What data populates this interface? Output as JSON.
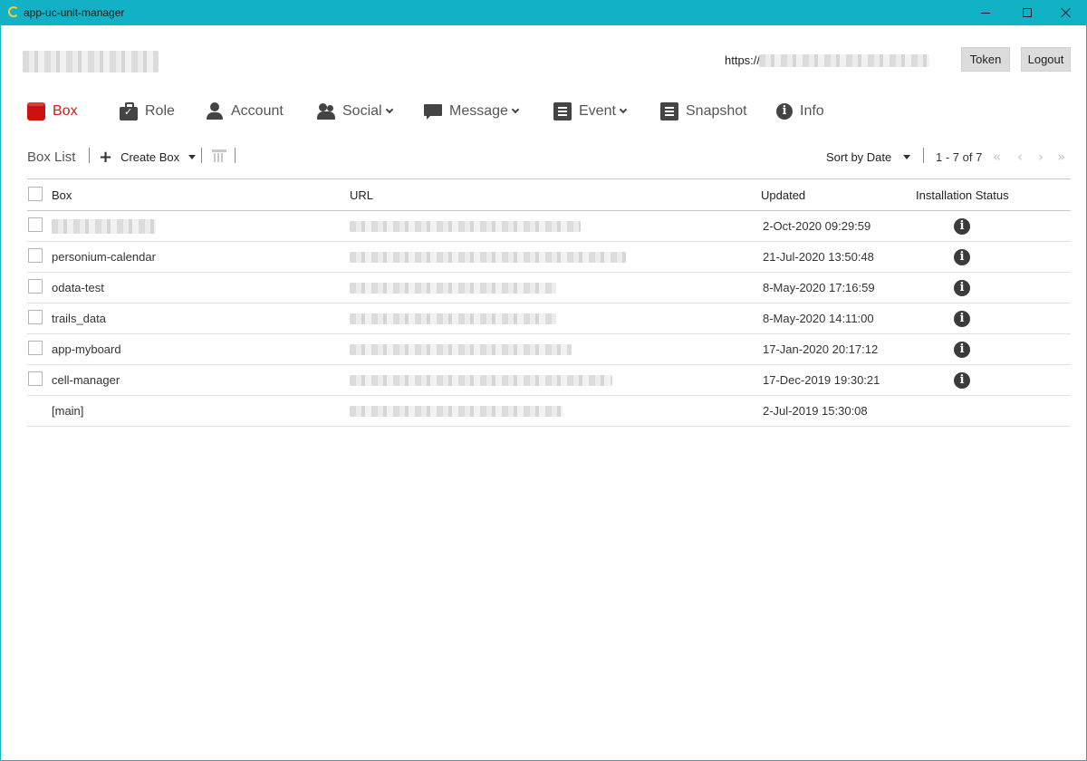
{
  "window": {
    "title": "app-uc-unit-manager"
  },
  "header": {
    "url_prefix": "https://",
    "token_label": "Token",
    "logout_label": "Logout"
  },
  "nav": {
    "box": "Box",
    "role": "Role",
    "account": "Account",
    "social": "Social",
    "message": "Message",
    "event": "Event",
    "snapshot": "Snapshot",
    "info": "Info"
  },
  "toolbar": {
    "title": "Box List",
    "create_box": "Create Box",
    "sort": "Sort by Date",
    "pager": "1 - 7 of 7",
    "first": "«",
    "prev": "‹",
    "next": "›",
    "last": "»"
  },
  "table": {
    "headers": {
      "box": "Box",
      "url": "URL",
      "updated": "Updated",
      "status": "Installation Status"
    },
    "rows": [
      {
        "box": "",
        "updated": "2-Oct-2020 09:29:59"
      },
      {
        "box": "personium-calendar",
        "updated": "21-Jul-2020 13:50:48"
      },
      {
        "box": "odata-test",
        "updated": "8-May-2020 17:16:59"
      },
      {
        "box": "trails_data",
        "updated": "8-May-2020 14:11:00"
      },
      {
        "box": "app-myboard",
        "updated": "17-Jan-2020 20:17:12"
      },
      {
        "box": "cell-manager",
        "updated": "17-Dec-2019 19:30:21"
      },
      {
        "box": "[main]",
        "updated": "2-Jul-2019 15:30:08"
      }
    ],
    "info_glyph": "i"
  },
  "colors": {
    "titlebar": "#12b1c5",
    "active_nav": "#cc1f1f",
    "icon": "#444444"
  }
}
